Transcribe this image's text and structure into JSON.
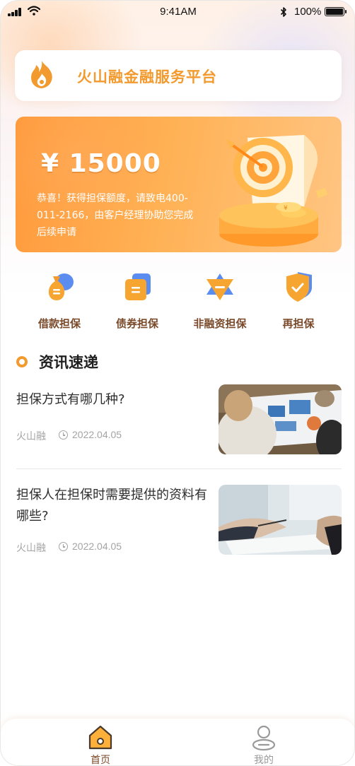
{
  "status_bar": {
    "time": "9:41AM",
    "battery": "100%"
  },
  "header": {
    "title": "火山融金融服务平台",
    "logo_icon": "flame-icon"
  },
  "banner": {
    "amount": "¥ 15000",
    "description": "恭喜！获得担保额度，请致电400-011-2166，由客户经理协助您完成后续申请"
  },
  "quick_actions": [
    {
      "label": "借款担保",
      "icon": "money-bag-icon"
    },
    {
      "label": "债券担保",
      "icon": "bond-document-icon"
    },
    {
      "label": "非融资担保",
      "icon": "star-minus-icon"
    },
    {
      "label": "再担保",
      "icon": "shield-check-icon"
    }
  ],
  "news": {
    "section_title": "资讯速递",
    "items": [
      {
        "title": "担保方式有哪几种?",
        "source": "火山融",
        "date": "2022.04.05"
      },
      {
        "title": "担保人在担保时需要提供的资料有哪些?",
        "source": "火山融",
        "date": "2022.04.05"
      }
    ]
  },
  "tab_bar": {
    "tabs": [
      {
        "label": "首页",
        "icon": "home-icon",
        "active": true
      },
      {
        "label": "我的",
        "icon": "user-icon",
        "active": false
      }
    ]
  },
  "colors": {
    "accent": "#f29a2e",
    "action_label": "#7a4a2b",
    "tab_active": "#7a4a2b",
    "tab_inactive": "#9a9a9a"
  }
}
